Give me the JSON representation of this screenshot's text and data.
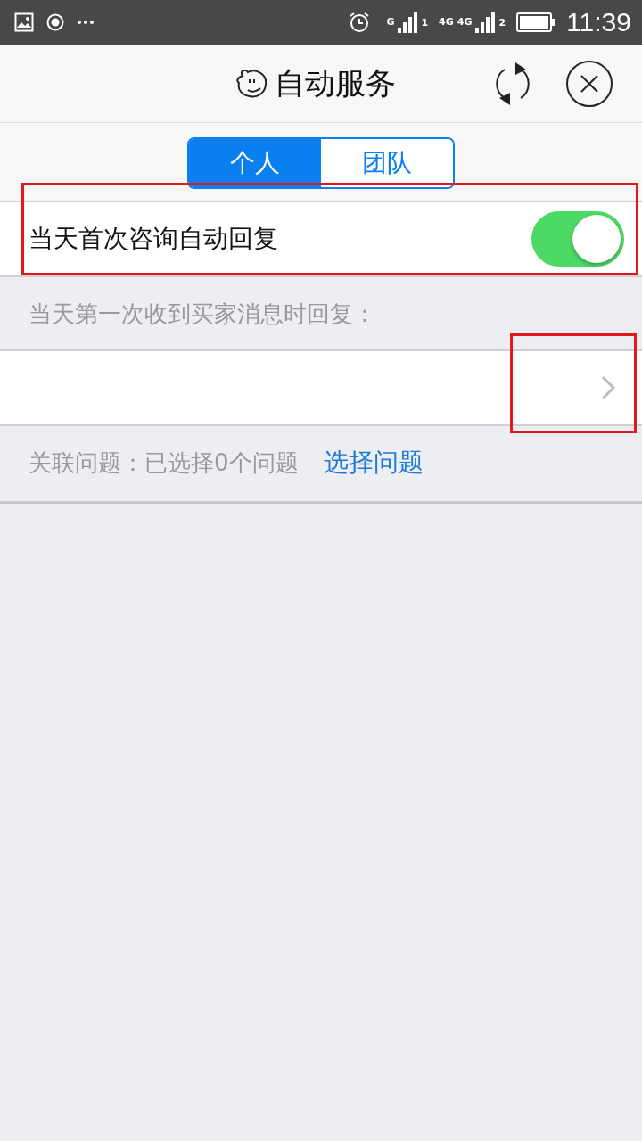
{
  "status_bar": {
    "sim1_network": "G",
    "sim1_slot": "1",
    "sim2_network_a": "4G",
    "sim2_network_b": "4G",
    "sim2_slot": "2",
    "time": "11:39"
  },
  "header": {
    "title": "自动服务"
  },
  "tabs": [
    {
      "label": "个人",
      "selected": true
    },
    {
      "label": "团队",
      "selected": false
    }
  ],
  "auto_reply": {
    "label": "当天首次咨询自动回复",
    "on": true,
    "highlighted": true
  },
  "reply_hint": "当天第一次收到买家消息时回复：",
  "reply_row": {
    "highlighted": true
  },
  "related": {
    "label": "关联问题：已选择0个问题",
    "link": "选择问题"
  }
}
